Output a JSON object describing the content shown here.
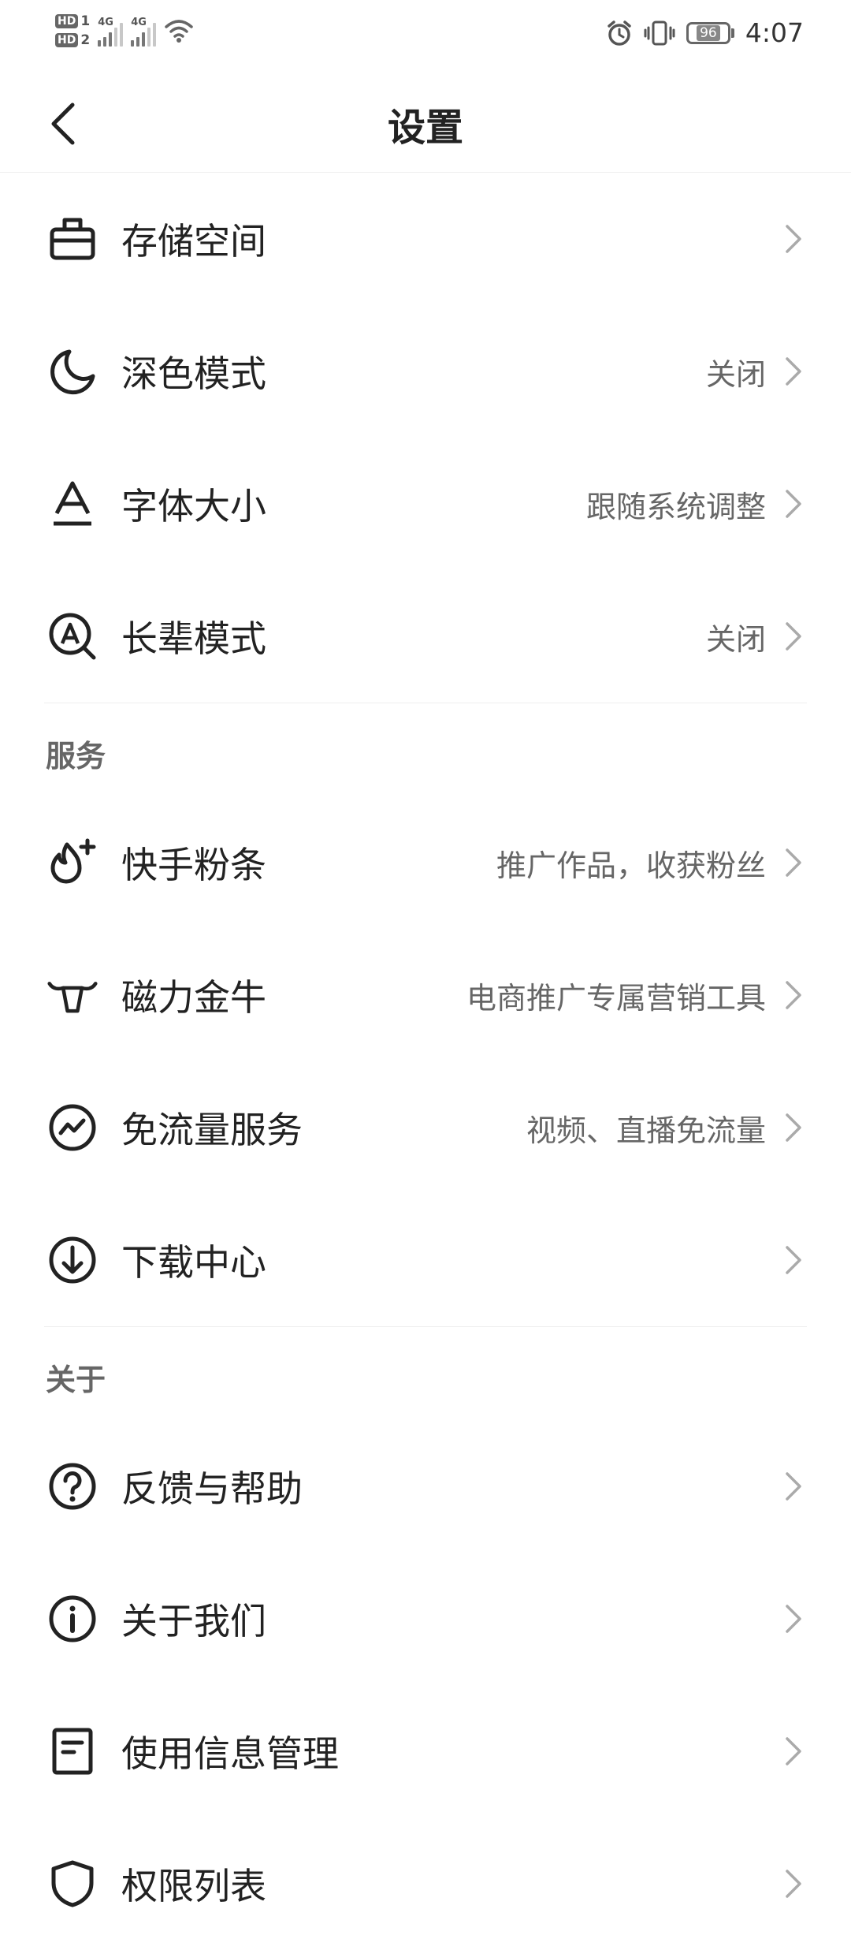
{
  "status_bar": {
    "sim1": "HD",
    "sim1_index": "1",
    "sim2": "HD",
    "sim2_index": "2",
    "net1": "4G",
    "net2": "4G",
    "battery": "96",
    "time": "4:07"
  },
  "header": {
    "title": "设置"
  },
  "items_top": [
    {
      "icon": "storage-icon",
      "label": "存储空间",
      "value": ""
    },
    {
      "icon": "moon-icon",
      "label": "深色模式",
      "value": "关闭"
    },
    {
      "icon": "font-size-icon",
      "label": "字体大小",
      "value": "跟随系统调整"
    },
    {
      "icon": "elder-mode-icon",
      "label": "长辈模式",
      "value": "关闭"
    }
  ],
  "section_service": "服务",
  "items_service": [
    {
      "icon": "fire-plus-icon",
      "label": "快手粉条",
      "value": "推广作品，收获粉丝"
    },
    {
      "icon": "bull-icon",
      "label": "磁力金牛",
      "value": "电商推广专属营销工具"
    },
    {
      "icon": "wave-circle-icon",
      "label": "免流量服务",
      "value": "视频、直播免流量"
    },
    {
      "icon": "download-icon",
      "label": "下载中心",
      "value": ""
    }
  ],
  "section_about": "关于",
  "items_about": [
    {
      "icon": "help-icon",
      "label": "反馈与帮助",
      "value": ""
    },
    {
      "icon": "info-icon",
      "label": "关于我们",
      "value": ""
    },
    {
      "icon": "document-icon",
      "label": "使用信息管理",
      "value": ""
    },
    {
      "icon": "permission-icon",
      "label": "权限列表",
      "value": ""
    }
  ]
}
